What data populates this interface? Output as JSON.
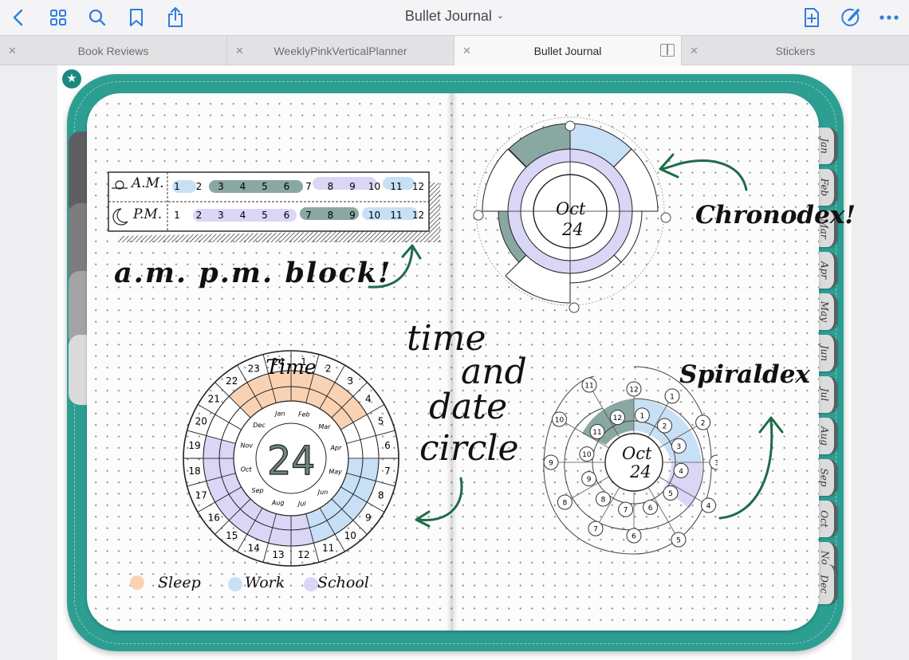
{
  "toolbar": {
    "title": "Bullet Journal",
    "icons": [
      "chevron-left",
      "grid",
      "search",
      "bookmark",
      "share",
      "new-page",
      "pen-circle",
      "more"
    ]
  },
  "tabs": [
    {
      "label": "Book Reviews",
      "active": false
    },
    {
      "label": "WeeklyPinkVerticalPlanner",
      "active": false
    },
    {
      "label": "Bullet Journal",
      "active": true
    },
    {
      "label": "Stickers",
      "active": false
    }
  ],
  "month_tabs": [
    "Jan",
    "Feb",
    "Mar",
    "Apr",
    "May",
    "Jun",
    "Jul",
    "Aug",
    "Sep",
    "Oct",
    "Nov",
    "Dec"
  ],
  "colors": {
    "teal": "#2d9e92",
    "sleep": "#f9d2b4",
    "work": "#c8e0f6",
    "school": "#d9d6f6",
    "dark_green": "#8aa8a2",
    "arrow": "#1e6b4a"
  },
  "ampm_block": {
    "am_label": "A.M.",
    "pm_label": "P.M.",
    "hours": [
      "1",
      "2",
      "3",
      "4",
      "5",
      "6",
      "7",
      "8",
      "9",
      "10",
      "11",
      "12"
    ],
    "caption": "a.m. p.m. block!"
  },
  "chronodex": {
    "caption": "Chronodex!",
    "date_month": "Oct",
    "date_day": "24"
  },
  "time_date_circle": {
    "caption_lines": [
      "time",
      "and",
      "date",
      "circle"
    ],
    "title": "Time",
    "hours": [
      "1",
      "2",
      "3",
      "4",
      "5",
      "6",
      "7",
      "8",
      "9",
      "10",
      "11",
      "12",
      "13",
      "14",
      "15",
      "16",
      "17",
      "18",
      "19",
      "20",
      "21",
      "22",
      "23",
      "24"
    ],
    "months": [
      "Jan",
      "Feb",
      "Mar",
      "Apr",
      "May",
      "Jun",
      "Jul",
      "Aug",
      "Sep",
      "Oct",
      "Nov",
      "Dec"
    ],
    "day": "24"
  },
  "spiraldex": {
    "caption": "Spiraldex",
    "date_month": "Oct",
    "date_day": "24",
    "nodes": [
      "12",
      "1",
      "2",
      "3",
      "4",
      "5",
      "6",
      "7",
      "8",
      "9",
      "10",
      "11"
    ]
  },
  "legend": [
    {
      "label": "Sleep",
      "color": "#f9d2b4"
    },
    {
      "label": "Work",
      "color": "#c8e0f6"
    },
    {
      "label": "School",
      "color": "#d9d6f6"
    }
  ]
}
